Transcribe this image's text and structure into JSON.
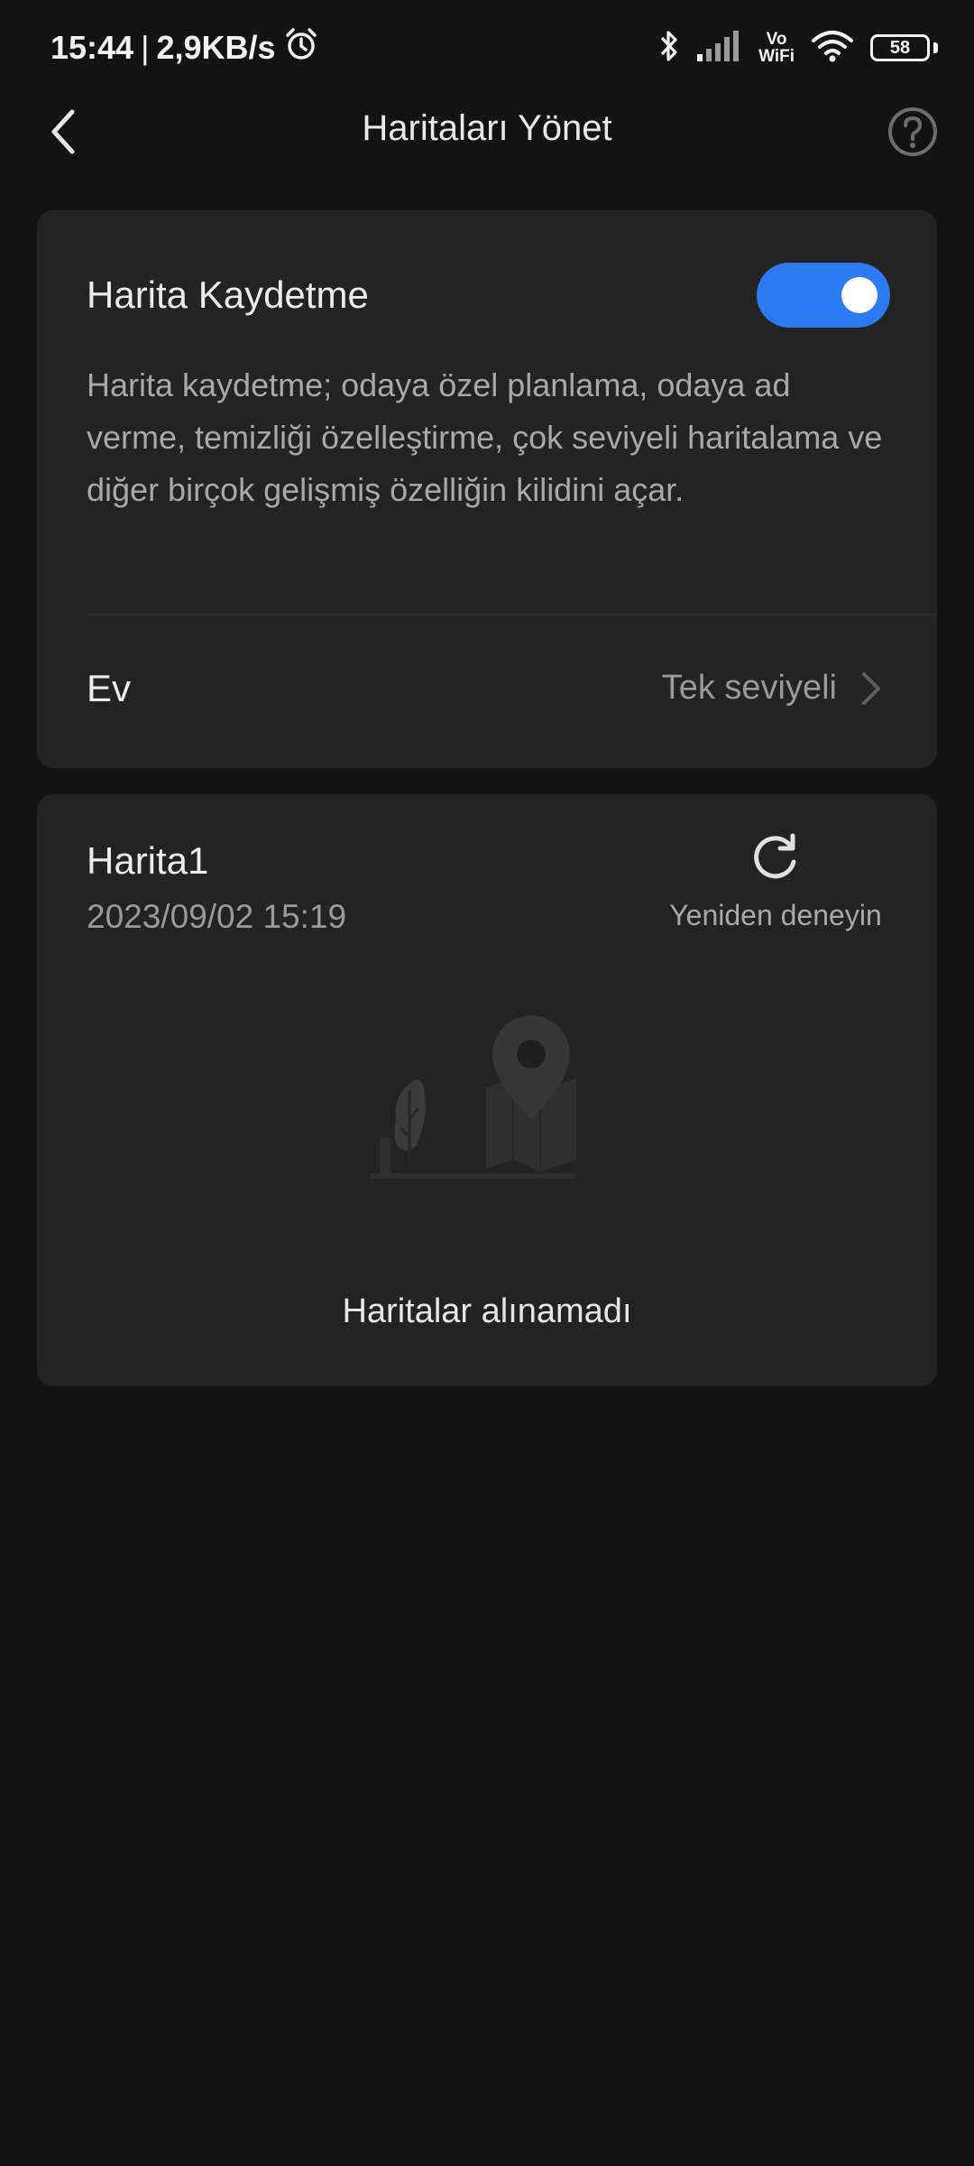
{
  "status_bar": {
    "time": "15:44",
    "separator": "|",
    "network_speed": "2,9KB/s",
    "alarm_icon": "alarm-clock-icon",
    "bluetooth_icon": "bluetooth-icon",
    "signal_icon": "cellular-signal-icon",
    "vowifi_top": "Vo",
    "vowifi_bottom": "WiFi",
    "wifi_icon": "wifi-icon",
    "battery_level": "58"
  },
  "header": {
    "title": "Haritaları Yönet",
    "back_icon": "chevron-left-icon",
    "help_icon": "help-circle-icon"
  },
  "map_saving": {
    "label": "Harita Kaydetme",
    "enabled": true,
    "description": "Harita kaydetme; odaya özel planlama, odaya ad verme, temizliği özelleştirme, çok seviyeli haritalama ve diğer birçok gelişmiş özelliğin kilidini açar.",
    "home_label": "Ev",
    "home_value": "Tek seviyeli"
  },
  "map_card": {
    "name": "Harita1",
    "date": "2023/09/02 15:19",
    "retry_label": "Yeniden deneyin",
    "error_message": "Haritalar alınamadı"
  },
  "colors": {
    "background": "#131313",
    "card": "#232323",
    "accent": "#2d7bf0"
  }
}
